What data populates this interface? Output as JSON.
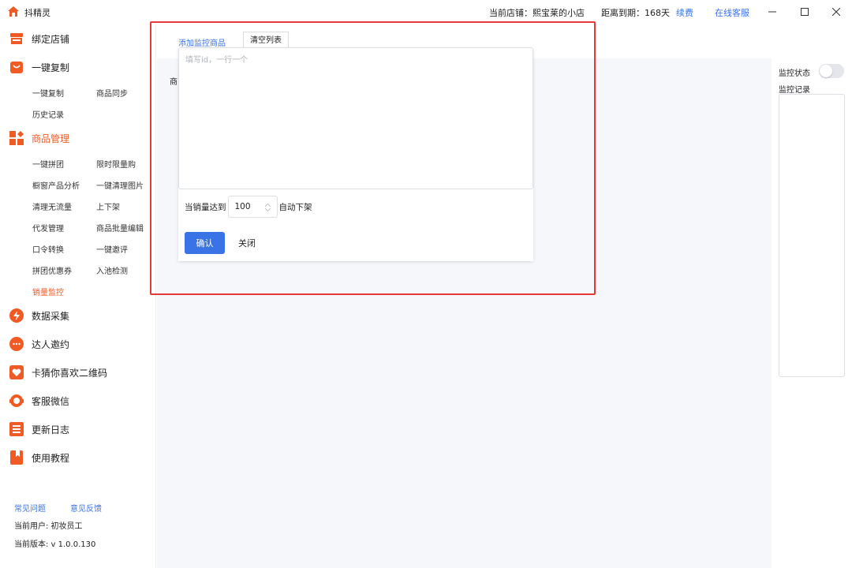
{
  "titlebar": {
    "app_name": "抖精灵",
    "store_label": "当前店铺：熙宝莱的小店",
    "expire_label": "距离到期：168天",
    "renew_link": "续费",
    "service_link": "在线客服",
    "icons": [
      "app-logo-icon",
      "minimize-icon",
      "maximize-icon",
      "close-icon"
    ]
  },
  "sidebar": {
    "groups": [
      {
        "label": "绑定店铺",
        "icon": "store-icon"
      },
      {
        "label": "一键复制",
        "icon": "shopping-bag-icon"
      },
      {
        "label": "商品管理",
        "icon": "grid-icon"
      },
      {
        "label": "数据采集",
        "icon": "lightning-icon"
      },
      {
        "label": "达人邀约",
        "icon": "chat-icon"
      },
      {
        "label": "卡猜你喜欢二维码",
        "icon": "heart-icon"
      },
      {
        "label": "客服微信",
        "icon": "headset-icon"
      },
      {
        "label": "更新日志",
        "icon": "list-icon"
      },
      {
        "label": "使用教程",
        "icon": "bookmark-icon"
      }
    ],
    "copy_subitems": [
      "一键复制",
      "商品同步",
      "历史记录"
    ],
    "manage_subitems": [
      "一键拼团",
      "限时限量购",
      "橱窗产品分析",
      "一键清理图片",
      "清理无流量",
      "上下架",
      "代发管理",
      "商品批量编辑",
      "口令转换",
      "一键邀评",
      "拼团优惠券",
      "入池检测",
      "销量监控"
    ],
    "footer": {
      "faq": "常见问题",
      "feedback": "意见反馈",
      "user": "当前用户: 初妆员工",
      "version": "当前版本: v 1.0.0.130"
    },
    "accent_color": "#f05a24"
  },
  "main": {
    "tab_add": "添加监控商品",
    "tab_clear": "清空列表",
    "product_label": "商",
    "popup": {
      "placeholder": "填写id，一行一个",
      "sales_prefix": "当销量达到",
      "sales_value": "100",
      "sales_suffix": "自动下架",
      "confirm": "确认",
      "close": "关闭"
    },
    "highlight_color": "#e53935"
  },
  "right": {
    "monitor_status": "监控状态",
    "monitor_log": "监控记录"
  }
}
